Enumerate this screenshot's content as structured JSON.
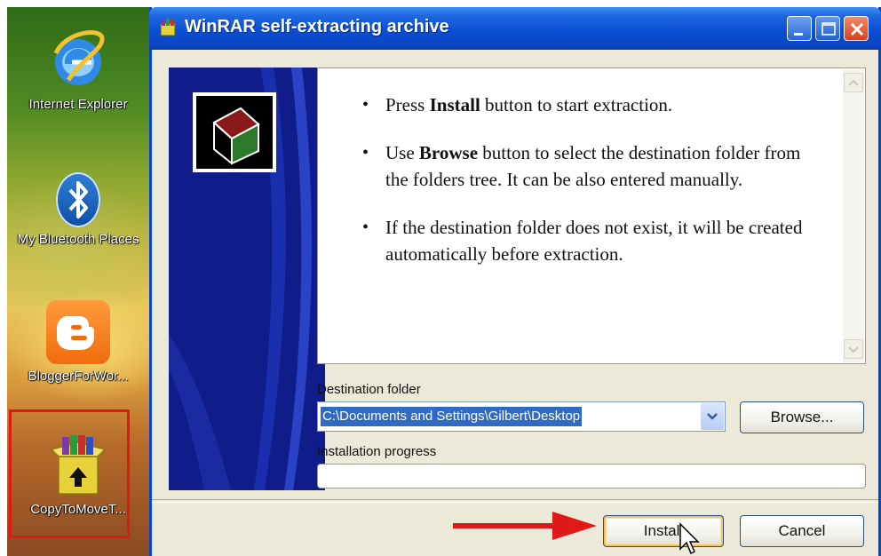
{
  "desktop": {
    "icons": [
      {
        "label": "Internet Explorer",
        "icon": "internet-explorer-icon"
      },
      {
        "label": "My Bluetooth Places",
        "icon": "bluetooth-icon"
      },
      {
        "label": "BloggerForWor...",
        "icon": "blogger-icon"
      },
      {
        "label": "CopyToMoveT...",
        "icon": "winrar-archive-icon",
        "selected": true
      }
    ]
  },
  "window": {
    "title": "WinRAR self-extracting archive",
    "controls": {
      "minimize": "minimize",
      "maximize": "maximize",
      "close": "close"
    },
    "info": {
      "items": [
        {
          "pre": "Press ",
          "bold": "Install",
          "post": " button to start extraction."
        },
        {
          "pre": "Use ",
          "bold": "Browse",
          "post": " button to select the destination folder from the folders tree. It can be also entered manually."
        },
        {
          "pre": "If the destination folder does not exist, it will be created automatically before extraction.",
          "bold": "",
          "post": ""
        }
      ]
    },
    "destination": {
      "label": "Destination folder",
      "value": "C:\\Documents and Settings\\Gilbert\\Desktop",
      "browse_label": "Browse..."
    },
    "progress": {
      "label": "Installation progress",
      "value": 0
    },
    "buttons": {
      "install": "Install",
      "cancel": "Cancel"
    }
  },
  "colors": {
    "titlebar": "#0a4fd4",
    "banner": "#0f1c8a",
    "highlight_box": "#e01818",
    "arrow": "#e01818",
    "selection": "#316ac5"
  }
}
